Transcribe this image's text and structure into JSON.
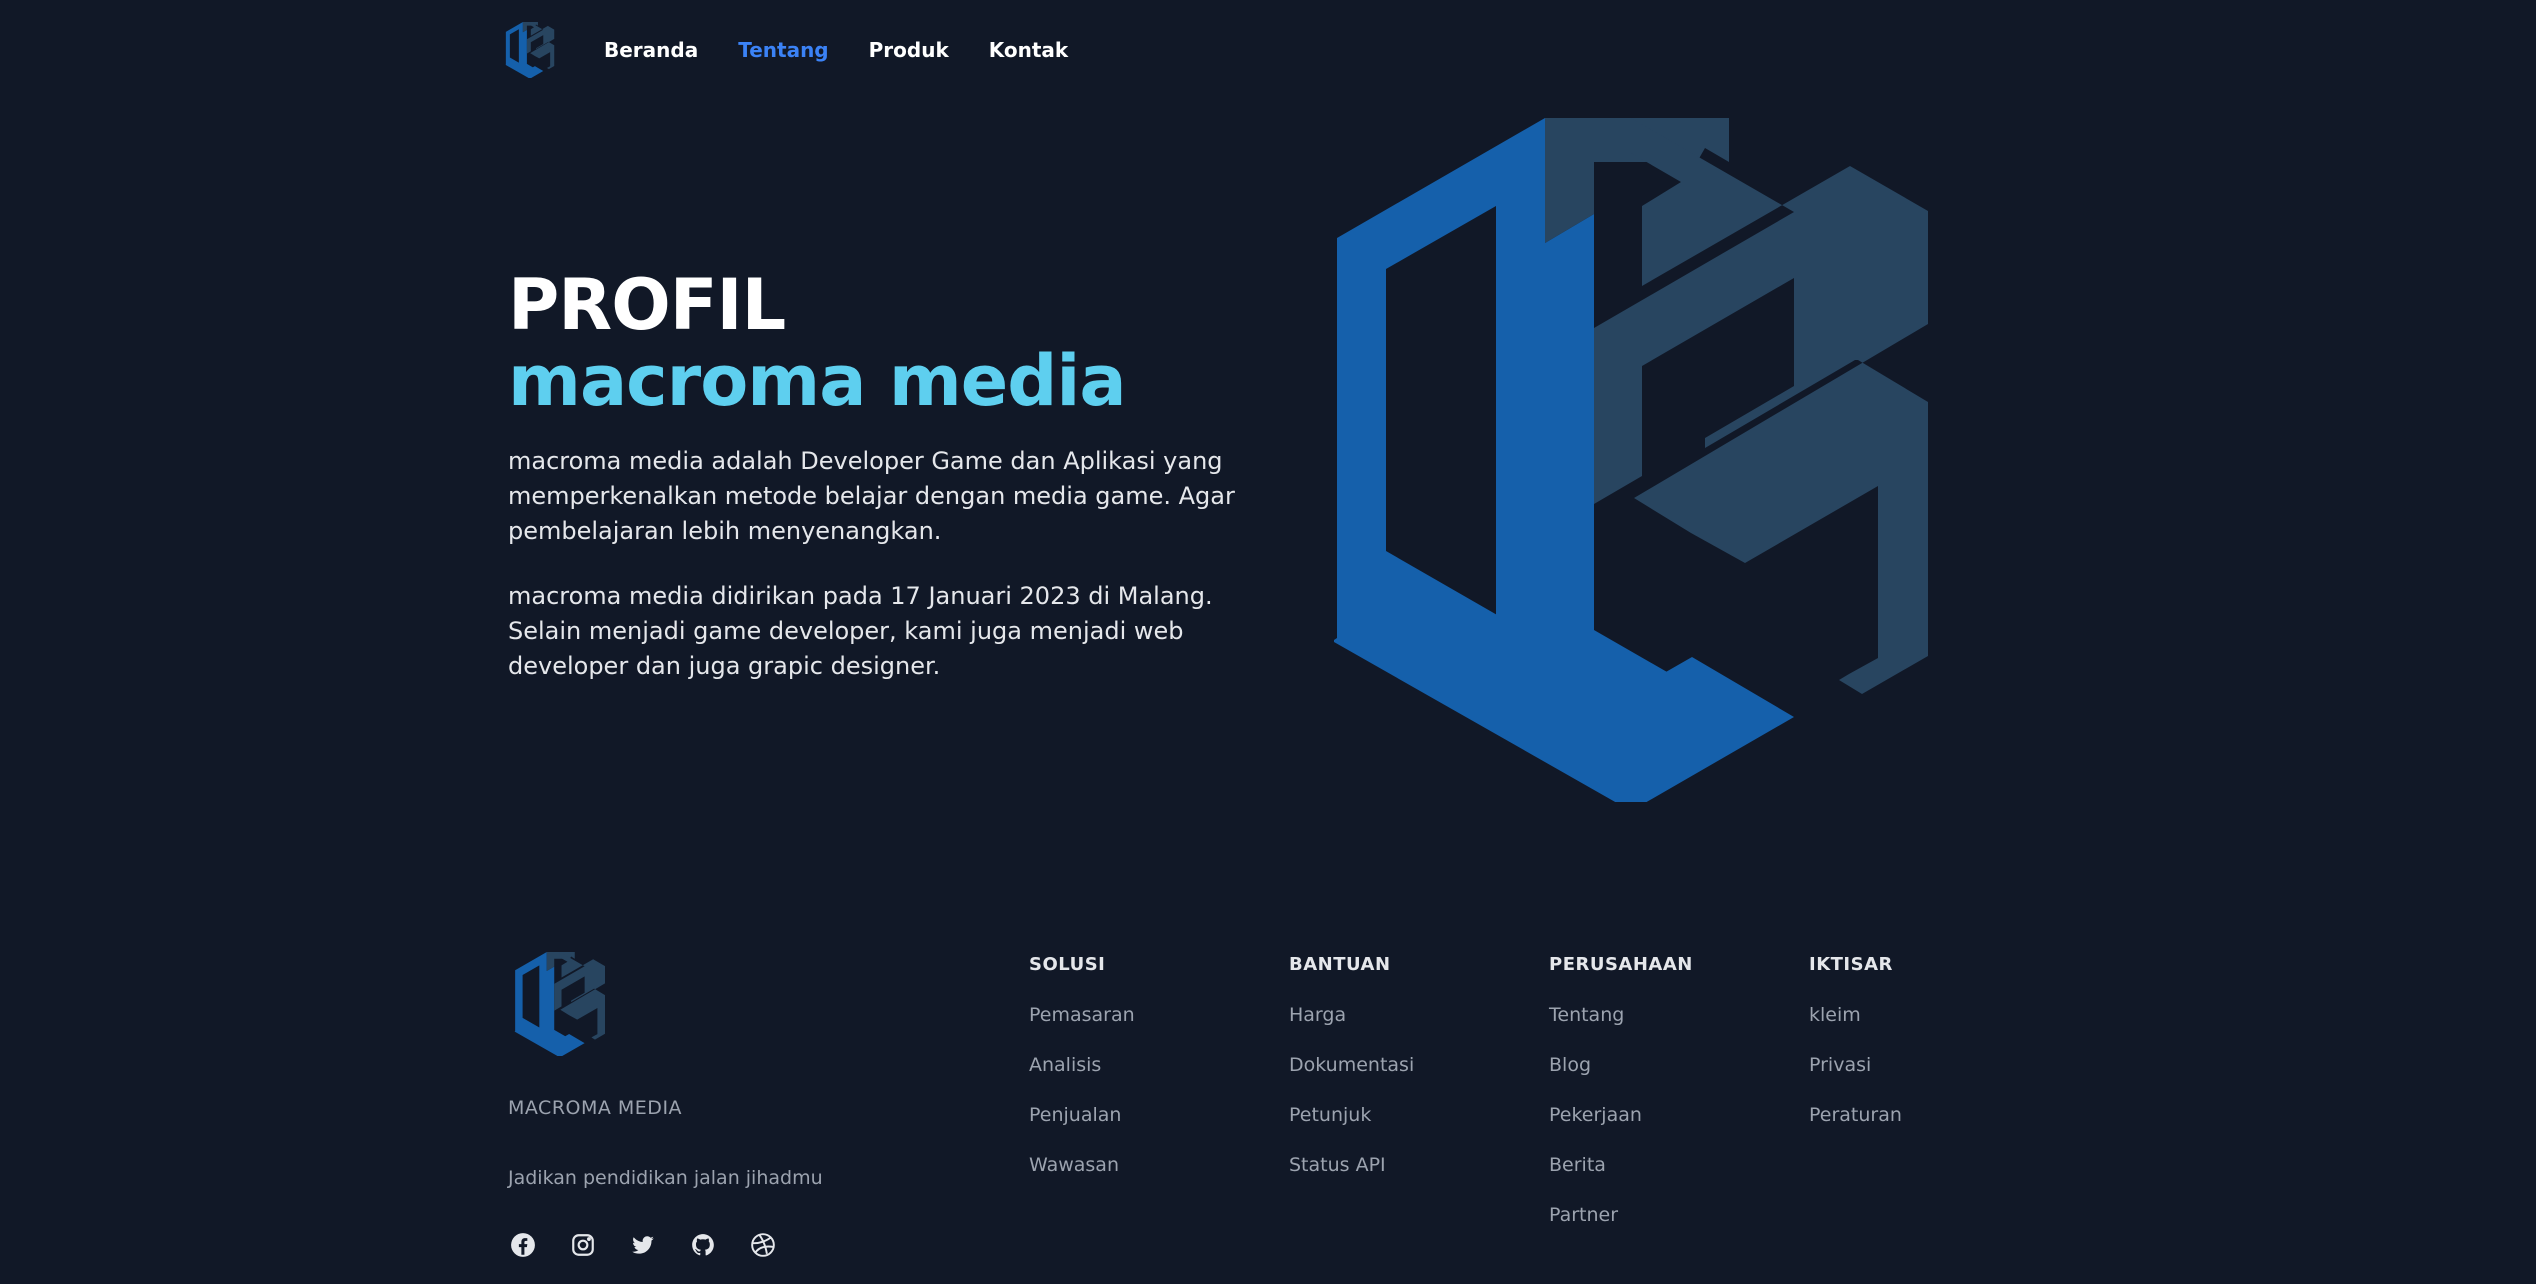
{
  "nav": {
    "links": [
      {
        "label": "Beranda",
        "active": false
      },
      {
        "label": "Tentang",
        "active": true
      },
      {
        "label": "Produk",
        "active": false
      },
      {
        "label": "Kontak",
        "active": false
      }
    ]
  },
  "hero": {
    "title_line1": "PROFIL",
    "title_line2": "macroma media",
    "paragraph1": "macroma media adalah Developer Game dan Aplikasi yang memperkenalkan metode belajar dengan media game. Agar pembelajaran lebih menyenangkan.",
    "paragraph2": "macroma media didirikan pada 17 Januari 2023 di Malang. Selain menjadi game developer, kami juga menjadi web developer dan juga grapic designer."
  },
  "footer": {
    "brand_name": "MACROMA MEDIA",
    "tagline": "Jadikan pendidikan jalan jihadmu",
    "social_icons": [
      "facebook-icon",
      "instagram-icon",
      "twitter-icon",
      "github-icon",
      "dribbble-icon"
    ],
    "columns": [
      {
        "title": "SOLUSI",
        "items": [
          "Pemasaran",
          "Analisis",
          "Penjualan",
          "Wawasan"
        ]
      },
      {
        "title": "BANTUAN",
        "items": [
          "Harga",
          "Dokumentasi",
          "Petunjuk",
          "Status API"
        ]
      },
      {
        "title": "PERUSAHAAN",
        "items": [
          "Tentang",
          "Blog",
          "Pekerjaan",
          "Berita",
          "Partner"
        ]
      },
      {
        "title": "IKTISAR",
        "items": [
          "kleim",
          "Privasi",
          "Peraturan"
        ]
      }
    ]
  },
  "colors": {
    "background": "#111827",
    "accent_blue": "#3b82f6",
    "logo_blue": "#1560ab",
    "logo_slate": "#284560",
    "title_cyan": "#5ecfef"
  }
}
